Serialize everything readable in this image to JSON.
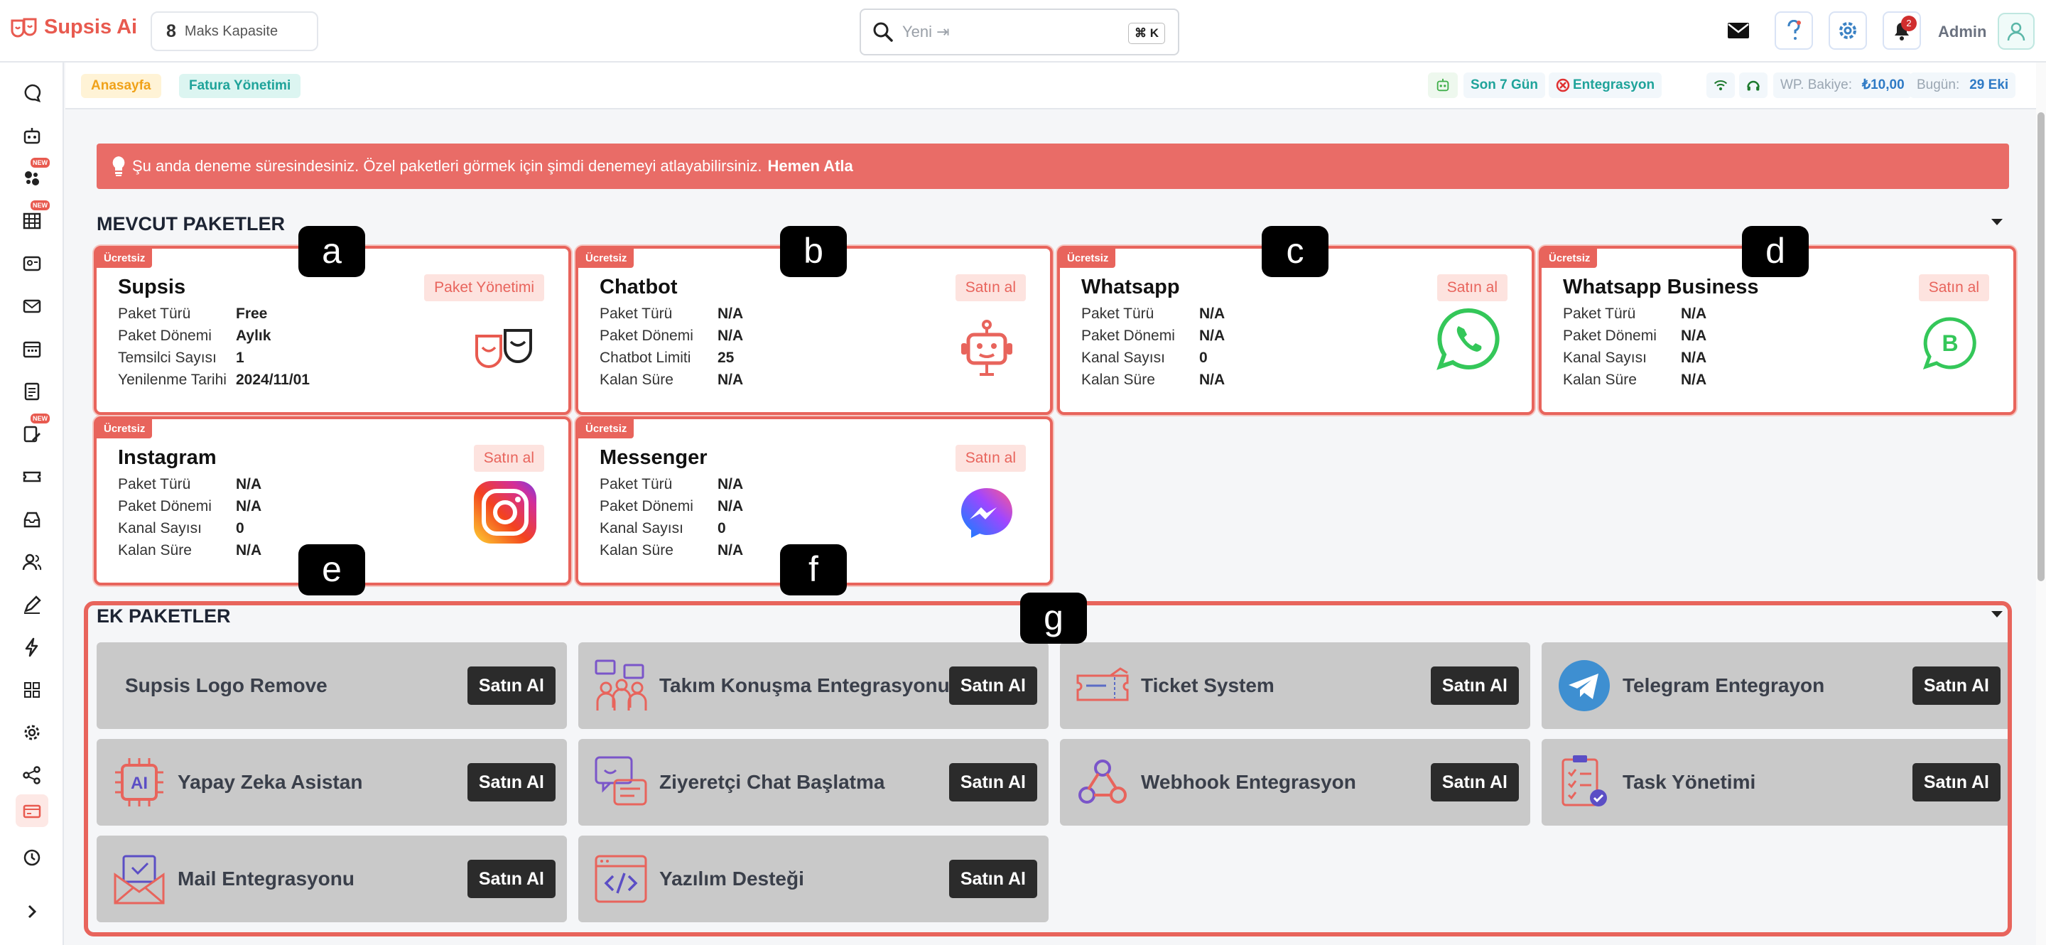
{
  "topbar": {
    "logo_text": "Supsis Ai",
    "capacity_number": "8",
    "capacity_label": "Maks Kapasite",
    "search_placeholder": "Yeni ⇥",
    "search_shortcut": "⌘ K",
    "notification_count": "2",
    "admin_label": "Admin"
  },
  "breadcrumb": {
    "home": "Anasayfa",
    "current": "Fatura Yönetimi"
  },
  "statusbar": {
    "period": "Son 7 Gün",
    "integration": "Entegrasyon",
    "wp_balance_label": "WP. Bakiye:",
    "wp_balance_value": "₺10,00",
    "today_label": "Bugün:",
    "today_value": "29 Eki"
  },
  "alert": {
    "text": "Şu anda deneme süresindesiniz. Özel paketleri görmek için şimdi denemeyi atlayabilirsiniz.",
    "link": "Hemen Atla"
  },
  "sections": {
    "current_packages": "MEVCUT PAKETLER",
    "extra_packages": "EK PAKETLER"
  },
  "packages": [
    {
      "badge": "Ücretsiz",
      "title": "Supsis",
      "action": "Paket Yönetimi",
      "icon": "supsis-logo-icon",
      "rows": [
        {
          "k": "Paket Türü",
          "v": "Free"
        },
        {
          "k": "Paket Dönemi",
          "v": "Aylık"
        },
        {
          "k": "Temsilci Sayısı",
          "v": "1"
        },
        {
          "k": "Yenilenme Tarihi",
          "v": "2024/11/01"
        }
      ]
    },
    {
      "badge": "Ücretsiz",
      "title": "Chatbot",
      "action": "Satın al",
      "icon": "robot-icon",
      "rows": [
        {
          "k": "Paket Türü",
          "v": "N/A"
        },
        {
          "k": "Paket Dönemi",
          "v": "N/A"
        },
        {
          "k": "Chatbot Limiti",
          "v": "25"
        },
        {
          "k": "Kalan Süre",
          "v": "N/A"
        }
      ]
    },
    {
      "badge": "Ücretsiz",
      "title": "Whatsapp",
      "action": "Satın al",
      "icon": "whatsapp-icon",
      "rows": [
        {
          "k": "Paket Türü",
          "v": "N/A"
        },
        {
          "k": "Paket Dönemi",
          "v": "N/A"
        },
        {
          "k": "Kanal Sayısı",
          "v": "0"
        },
        {
          "k": "Kalan Süre",
          "v": "N/A"
        }
      ]
    },
    {
      "badge": "Ücretsiz",
      "title": "Whatsapp Business",
      "action": "Satın al",
      "icon": "whatsapp-business-icon",
      "rows": [
        {
          "k": "Paket Türü",
          "v": "N/A"
        },
        {
          "k": "Paket Dönemi",
          "v": "N/A"
        },
        {
          "k": "Kanal Sayısı",
          "v": "N/A"
        },
        {
          "k": "Kalan Süre",
          "v": "N/A"
        }
      ]
    },
    {
      "badge": "Ücretsiz",
      "title": "Instagram",
      "action": "Satın al",
      "icon": "instagram-icon",
      "rows": [
        {
          "k": "Paket Türü",
          "v": "N/A"
        },
        {
          "k": "Paket Dönemi",
          "v": "N/A"
        },
        {
          "k": "Kanal Sayısı",
          "v": "0"
        },
        {
          "k": "Kalan Süre",
          "v": "N/A"
        }
      ]
    },
    {
      "badge": "Ücretsiz",
      "title": "Messenger",
      "action": "Satın al",
      "icon": "messenger-icon",
      "rows": [
        {
          "k": "Paket Türü",
          "v": "N/A"
        },
        {
          "k": "Paket Dönemi",
          "v": "N/A"
        },
        {
          "k": "Kanal Sayısı",
          "v": "0"
        },
        {
          "k": "Kalan Süre",
          "v": "N/A"
        }
      ]
    }
  ],
  "extras": [
    {
      "name": "Supsis Logo Remove",
      "button": "Satın Al",
      "icon": "none"
    },
    {
      "name": "Takım Konuşma Entegrasyonu",
      "button": "Satın Al",
      "icon": "team-chat-icon"
    },
    {
      "name": "Ticket System",
      "button": "Satın Al",
      "icon": "ticket-icon"
    },
    {
      "name": "Telegram Entegrayon",
      "button": "Satın Al",
      "icon": "telegram-icon"
    },
    {
      "name": "Yapay Zeka Asistan",
      "button": "Satın Al",
      "icon": "ai-chip-icon"
    },
    {
      "name": "Ziyeretçi Chat Başlatma",
      "button": "Satın Al",
      "icon": "visitor-chat-icon"
    },
    {
      "name": "Webhook Entegrasyon",
      "button": "Satın Al",
      "icon": "webhook-icon"
    },
    {
      "name": "Task Yönetimi",
      "button": "Satın Al",
      "icon": "task-list-icon"
    },
    {
      "name": "Mail Entegrasyonu",
      "button": "Satın Al",
      "icon": "mail-icon"
    },
    {
      "name": "Yazılım Desteği",
      "button": "Satın Al",
      "icon": "code-window-icon"
    }
  ],
  "labels": [
    "a",
    "b",
    "c",
    "d",
    "e",
    "f",
    "g"
  ],
  "colors": {
    "accent": "#e8645c",
    "alert_bg": "#e96c67",
    "teal": "#1fa39a",
    "whatsapp": "#34c759"
  }
}
